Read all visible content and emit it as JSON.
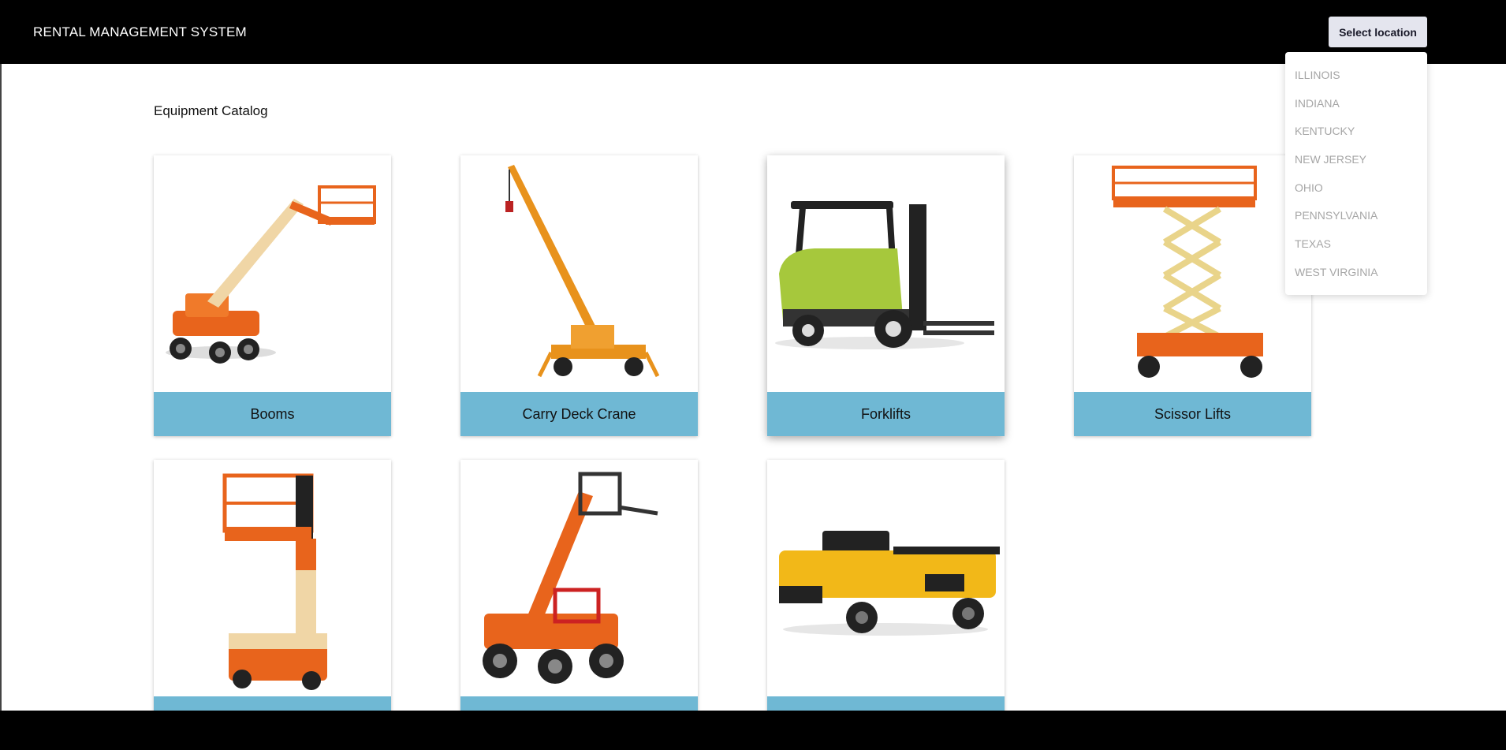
{
  "header": {
    "app_title": "RENTAL MANAGEMENT SYSTEM",
    "location_button_label": "Select location"
  },
  "main": {
    "title": "Equipment Catalog",
    "cards": [
      {
        "label": "Booms",
        "icon": "boom-lift-image"
      },
      {
        "label": "Carry Deck Crane",
        "icon": "carry-deck-crane-image"
      },
      {
        "label": "Forklifts",
        "icon": "forklift-image"
      },
      {
        "label": "Scissor Lifts",
        "icon": "scissor-lift-image"
      },
      {
        "label": "",
        "icon": "vertical-mast-lift-image"
      },
      {
        "label": "",
        "icon": "telehandler-image"
      },
      {
        "label": "",
        "icon": "utility-vehicle-image"
      }
    ]
  },
  "location_dropdown": {
    "options": [
      "ILLINOIS",
      "INDIANA",
      "KENTUCKY",
      "NEW JERSEY",
      "OHIO",
      "PENNSYLVANIA",
      "TEXAS",
      "WEST VIRGINIA"
    ]
  },
  "colors": {
    "header_bg": "#000000",
    "card_label_bg": "#6fb8d4",
    "equipment_orange": "#e8641c",
    "forklift_green": "#a6c83c",
    "utility_yellow": "#f2b818"
  }
}
